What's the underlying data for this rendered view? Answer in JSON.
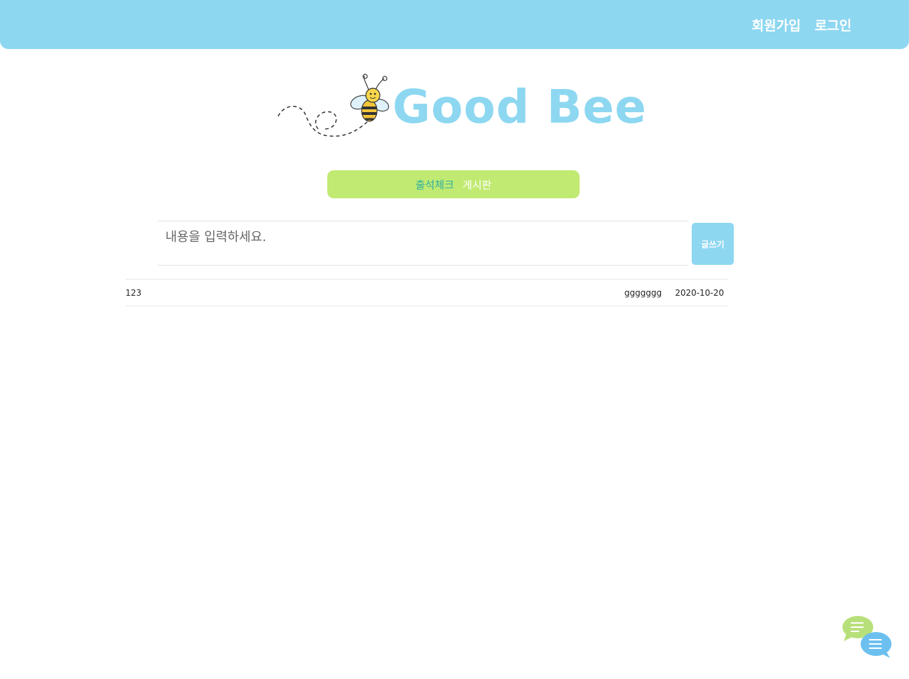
{
  "header": {
    "nav": {
      "signup": "회원가입",
      "login": "로그인"
    },
    "colors": {
      "bar": "#8dd7f1"
    }
  },
  "logo": {
    "brand": "Good Bee",
    "icon": "bee-icon",
    "color": "#8dd7f1"
  },
  "board_tab": {
    "label_main": "출석체크",
    "label_sub": "게시판",
    "color": "#c1ea72"
  },
  "compose": {
    "placeholder": "내용을 입력하세요.",
    "submit_label": "글쓰기"
  },
  "posts": [
    {
      "content": "123",
      "author": "ggggggg",
      "date": "2020-10-20"
    }
  ],
  "floating": {
    "icon": "chat-bubbles-icon"
  }
}
